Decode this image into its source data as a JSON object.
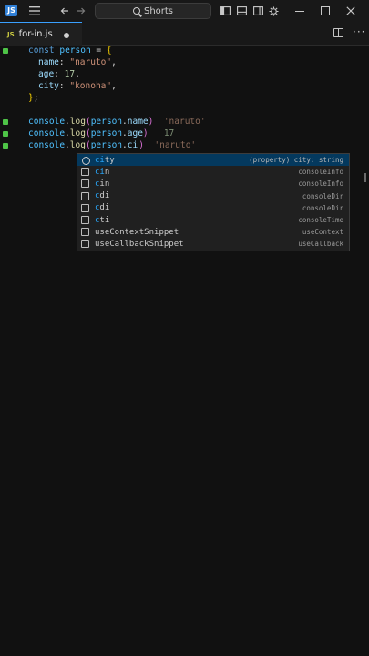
{
  "titlebar": {
    "app_logo": "JS",
    "search_text": "Shorts",
    "icons": [
      "menu-icon",
      "back-arrow-icon",
      "forward-arrow-icon",
      "toggle-sidebar-icon",
      "toggle-panel-icon",
      "toggle-secondary-sidebar-icon",
      "customize-layout-icon",
      "settings-gear-icon",
      "minimize-icon",
      "maximize-icon",
      "close-icon"
    ]
  },
  "tab": {
    "lang": "JS",
    "filename": "for-in.js"
  },
  "code": {
    "l1": {
      "kw": "const",
      "name": "person",
      "eq": "=",
      "brace": "{"
    },
    "l2": {
      "key": "name",
      "val": "\"naruto\"",
      "comma": ","
    },
    "l3": {
      "key": "age",
      "val": "17",
      "comma": ","
    },
    "l4": {
      "key": "city",
      "val": "\"konoha\"",
      "comma": ","
    },
    "l5": {
      "brace": "}",
      "semi": ";"
    },
    "l6": {
      "obj": "console",
      "fn": "log",
      "arg_obj": "person",
      "arg_prop": "name",
      "ghost": "'naruto'"
    },
    "l7": {
      "obj": "console",
      "fn": "log",
      "arg_obj": "person",
      "arg_prop": "age",
      "ghost": "17"
    },
    "l8": {
      "obj": "console",
      "fn": "log",
      "arg_obj": "person",
      "arg_prop": "ci",
      "ghost": "'naruto'"
    }
  },
  "suggestions": [
    {
      "match": "ci",
      "rest": "ty",
      "detail": "(property) city: string",
      "kind": "property"
    },
    {
      "match": "ci",
      "rest": "n",
      "detail": "consoleInfo",
      "kind": "snippet"
    },
    {
      "match": "c",
      "rest": "in",
      "detail": "consoleInfo",
      "kind": "snippet"
    },
    {
      "match": "c",
      "rest": "di",
      "detail": "consoleDir",
      "kind": "snippet"
    },
    {
      "match": "c",
      "rest": "di",
      "detail": "consoleDir",
      "kind": "snippet"
    },
    {
      "match": "c",
      "rest": "ti",
      "detail": "consoleTime",
      "kind": "snippet"
    },
    {
      "match": "",
      "rest": "useContextSnippet",
      "detail": "useContext",
      "kind": "snippet"
    },
    {
      "match": "",
      "rest": "useCallbackSnippet",
      "detail": "useCallback",
      "kind": "snippet"
    }
  ]
}
